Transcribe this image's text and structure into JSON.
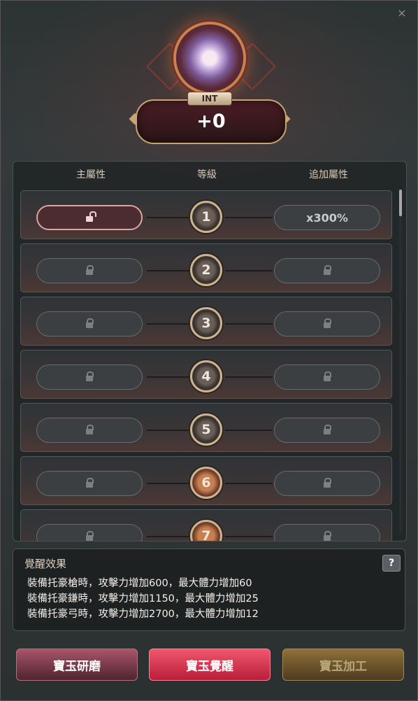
{
  "window": {
    "close_glyph": "×"
  },
  "stat": {
    "label": "INT",
    "value": "+0"
  },
  "table": {
    "headers": {
      "main": "主屬性",
      "level": "等級",
      "extra": "追加屬性"
    },
    "rows": [
      {
        "level": "1",
        "main_state": "unlocked",
        "extra_value": "x300%"
      },
      {
        "level": "2",
        "main_state": "locked",
        "extra_value": ""
      },
      {
        "level": "3",
        "main_state": "locked",
        "extra_value": ""
      },
      {
        "level": "4",
        "main_state": "locked",
        "extra_value": ""
      },
      {
        "level": "5",
        "main_state": "locked",
        "extra_value": ""
      },
      {
        "level": "6",
        "main_state": "locked",
        "extra_value": ""
      },
      {
        "level": "7",
        "main_state": "locked",
        "extra_value": ""
      }
    ]
  },
  "effect": {
    "title": "覺醒效果",
    "help": "?",
    "lines": [
      "裝備托豪槍時，攻擊力增加600，最大體力增加60",
      "裝備托豪鎌時，攻擊力增加1150，最大體力增加25",
      "裝備托豪弓時，攻擊力增加2700，最大體力增加12"
    ]
  },
  "buttons": {
    "grind": "寶玉研磨",
    "awaken": "寶玉覺醒",
    "process": "寶玉加工"
  },
  "colors": {
    "accent": "#e0485f",
    "gold": "#c8a56f"
  }
}
